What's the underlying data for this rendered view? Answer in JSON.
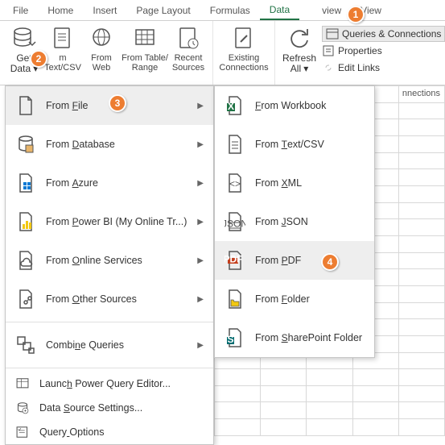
{
  "tabs": {
    "file": "File",
    "home": "Home",
    "insert": "Insert",
    "page_layout": "Page Layout",
    "formulas": "Formulas",
    "data": "Data",
    "review": "view",
    "view": "View"
  },
  "ribbon": {
    "get_data": "Get\nData",
    "from_text_csv": "m\nText/CSV",
    "from_web": "From\nWeb",
    "from_table_range": "From Table/\nRange",
    "recent_sources": "Recent\nSources",
    "existing_connections": "Existing\nConnections",
    "refresh_all": "Refresh\nAll",
    "queries_connections": "Queries & Connections",
    "properties": "Properties",
    "edit_links": "Edit Links"
  },
  "menu1": [
    {
      "label": "From File",
      "icon": "file-icon",
      "arrow": true,
      "hover": true
    },
    {
      "label": "From Database",
      "icon": "database-icon",
      "arrow": true
    },
    {
      "label": "From Azure",
      "icon": "azure-icon",
      "arrow": true
    },
    {
      "label": "From Power BI (My Online Tr...)",
      "icon": "powerbi-icon",
      "arrow": true
    },
    {
      "label": "From Online Services",
      "icon": "cloud-icon",
      "arrow": true
    },
    {
      "label": "From Other Sources",
      "icon": "other-icon",
      "arrow": true
    }
  ],
  "menu1b": [
    {
      "label": "Combine Queries",
      "icon": "combine-icon",
      "arrow": true
    }
  ],
  "menu1c": [
    {
      "label": "Launch Power Query Editor...",
      "icon": "editor-icon"
    },
    {
      "label": "Data Source Settings...",
      "icon": "settings-icon"
    },
    {
      "label": "Query Options",
      "icon": "options-icon"
    }
  ],
  "menu2": [
    {
      "label": "From Workbook",
      "icon": "excel-icon",
      "u": 0
    },
    {
      "label": "From Text/CSV",
      "icon": "text-icon",
      "u": 5
    },
    {
      "label": "From XML",
      "icon": "xml-icon",
      "u": 5
    },
    {
      "label": "From JSON",
      "icon": "json-icon",
      "u": 5
    },
    {
      "label": "From PDF",
      "icon": "pdf-icon",
      "u": 5,
      "hover": true
    },
    {
      "label": "From Folder",
      "icon": "folder-icon",
      "u": 5
    },
    {
      "label": "From SharePoint Folder",
      "icon": "sharepoint-icon",
      "u": 5
    }
  ],
  "badges": {
    "1": "1",
    "2": "2",
    "3": "3",
    "4": "4"
  },
  "conn_label": "nnections"
}
